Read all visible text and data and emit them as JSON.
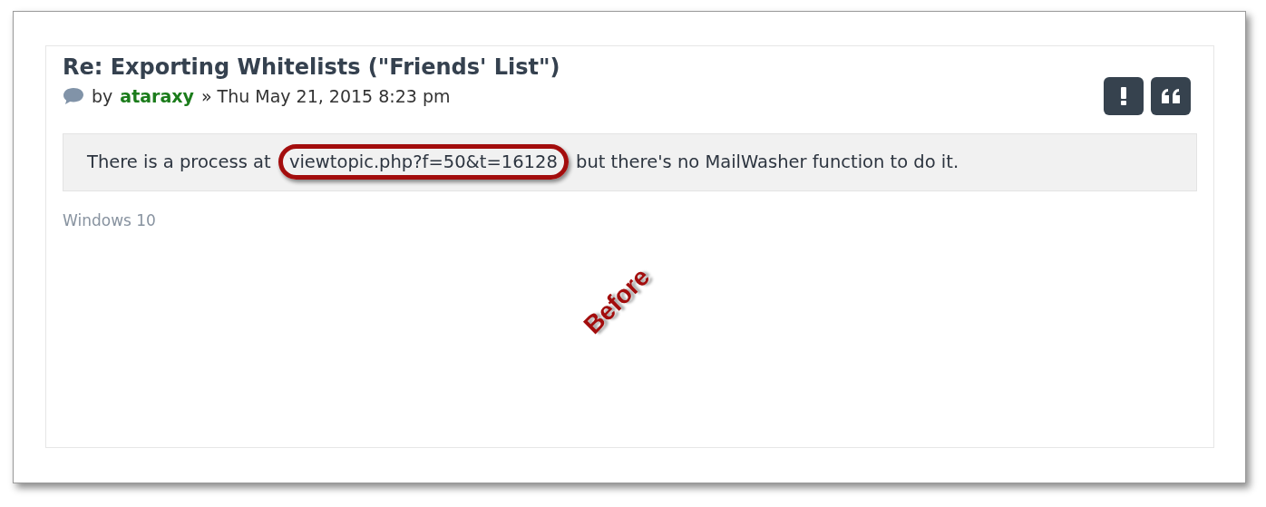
{
  "post": {
    "title": "Re: Exporting Whitelists (\"Friends' List\")",
    "by": "by",
    "author": "ataraxy",
    "separator": "»",
    "date": "Thu May 21, 2015 8:23 pm",
    "buttons": [
      {
        "kind": "report"
      },
      {
        "kind": "quote"
      }
    ],
    "body": {
      "before": "There is a process at",
      "link": "viewtopic.php?f=50&t=16128",
      "after": "but there's no MailWasher function to do it."
    },
    "signature": "Windows 10"
  },
  "annotation": {
    "label": "Before"
  }
}
